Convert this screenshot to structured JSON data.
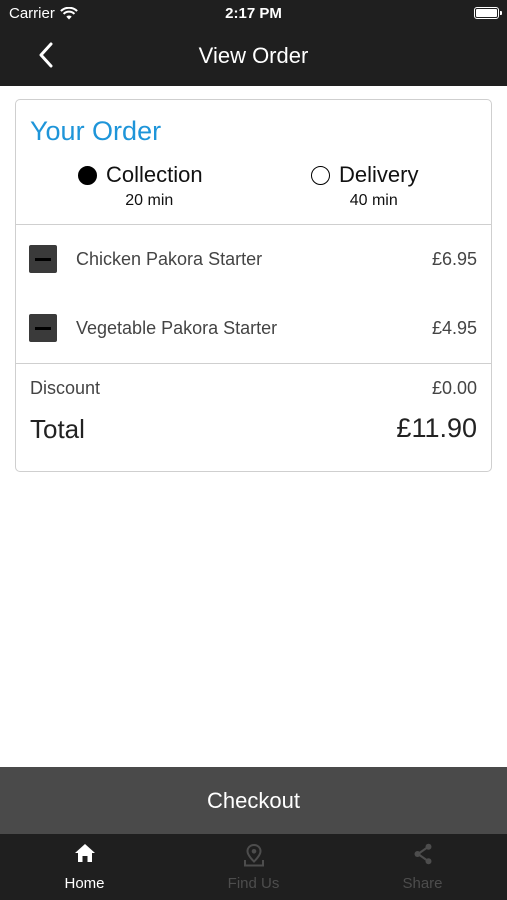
{
  "status_bar": {
    "carrier": "Carrier",
    "time": "2:17 PM",
    "icons": [
      "wifi-icon",
      "battery-icon"
    ]
  },
  "nav": {
    "title": "View Order",
    "back_icon": "chevron-left-icon"
  },
  "order": {
    "title": "Your Order",
    "title_color": "#1e95d9",
    "options": [
      {
        "label": "Collection",
        "time": "20 min",
        "selected": true
      },
      {
        "label": "Delivery",
        "time": "40 min",
        "selected": false
      }
    ],
    "items": [
      {
        "name": "Chicken Pakora Starter",
        "price": "£6.95"
      },
      {
        "name": "Vegetable Pakora Starter",
        "price": "£4.95"
      }
    ],
    "discount_label": "Discount",
    "discount_value": "£0.00",
    "total_label": "Total",
    "total_value": "£11.90"
  },
  "checkout": {
    "label": "Checkout"
  },
  "tabs": [
    {
      "label": "Home",
      "icon": "home-icon",
      "active": true
    },
    {
      "label": "Find Us",
      "icon": "location-pin-icon",
      "active": false
    },
    {
      "label": "Share",
      "icon": "share-icon",
      "active": false
    }
  ]
}
